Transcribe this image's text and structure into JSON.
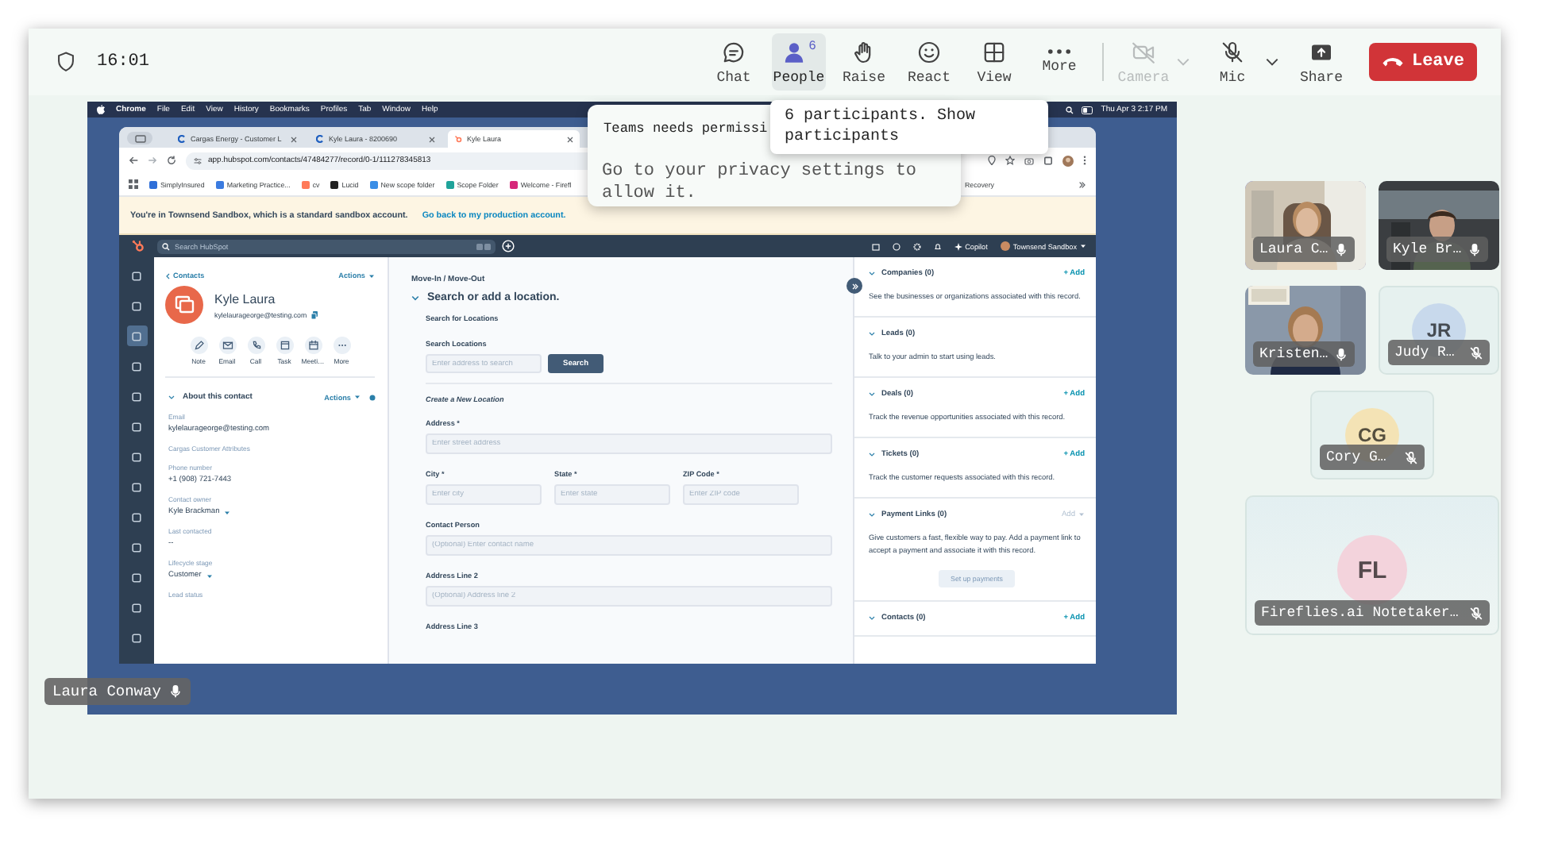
{
  "top_bar": {
    "time": "16:01",
    "buttons": [
      {
        "kind": "chat",
        "label": "Chat",
        "selected": false,
        "disabled": false,
        "dropdown": false
      },
      {
        "kind": "people",
        "label": "People",
        "badge": "6",
        "selected": true,
        "disabled": false,
        "dropdown": false
      },
      {
        "kind": "raise",
        "label": "Raise",
        "selected": false,
        "disabled": false,
        "dropdown": false
      },
      {
        "kind": "react",
        "label": "React",
        "selected": false,
        "disabled": false,
        "dropdown": false
      },
      {
        "kind": "view",
        "label": "View",
        "selected": false,
        "disabled": false,
        "dropdown": false
      },
      {
        "kind": "more",
        "label": "More",
        "selected": false,
        "disabled": false,
        "dropdown": false
      },
      {
        "kind": "camera",
        "label": "Camera",
        "selected": false,
        "disabled": true,
        "dropdown": true
      },
      {
        "kind": "mic",
        "label": "Mic",
        "selected": false,
        "disabled": false,
        "dropdown": true
      },
      {
        "kind": "share",
        "label": "Share",
        "selected": false,
        "disabled": false,
        "dropdown": false
      }
    ],
    "leave": "Leave"
  },
  "permission_popup": {
    "title": "Teams needs permissi",
    "message": "Go to your privacy settings to allow it."
  },
  "people_tooltip": "6 participants. Show participants",
  "shared_screen": {
    "menubar": {
      "items": [
        "Chrome",
        "File",
        "Edit",
        "View",
        "History",
        "Bookmarks",
        "Profiles",
        "Tab",
        "Window",
        "Help"
      ],
      "clock": "Thu Apr 3  2:17 PM"
    },
    "browser": {
      "tabs": [
        {
          "title": "Cargas Energy - Customer L",
          "selected": false
        },
        {
          "title": "Kyle Laura - 8200690",
          "selected": false
        },
        {
          "title": "Kyle Laura",
          "selected": true
        }
      ],
      "url": "app.hubspot.com/contacts/47484277/record/0-1/111278345813",
      "bookmarks": [
        {
          "label": "SimplyInsured",
          "color": "#2f6fd8"
        },
        {
          "label": "Marketing Practice...",
          "color": "#3b7be0"
        },
        {
          "label": "cv",
          "color": "#ff7a59"
        },
        {
          "label": "Lucid",
          "color": "#222222"
        },
        {
          "label": "New scope folder",
          "color": "#3a8ee6"
        },
        {
          "label": "Scope Folder",
          "color": "#1fa39a"
        },
        {
          "label": "Welcome - Firefl",
          "color": "#d6287a"
        }
      ],
      "bookmark_end": "Recovery"
    },
    "banner": {
      "text": "You're in Townsend Sandbox, which is a standard sandbox account.",
      "link": "Go back to my production account."
    },
    "hubspot": {
      "search_placeholder": "Search HubSpot",
      "copilot": "Copilot",
      "account": "Townsend Sandbox",
      "nav_items": [
        {
          "selected": false
        },
        {
          "selected": false
        },
        {
          "selected": true
        },
        {
          "selected": false
        },
        {
          "selected": false
        },
        {
          "selected": false
        },
        {
          "selected": false
        },
        {
          "selected": false
        },
        {
          "selected": false
        },
        {
          "selected": false
        },
        {
          "selected": false
        },
        {
          "selected": false
        },
        {
          "selected": false
        }
      ],
      "contact": {
        "back": "Contacts",
        "actions": "Actions",
        "name": "Kyle Laura",
        "email": "kylelaurageorge@testing.com",
        "quick_actions": [
          {
            "kind": "note",
            "label": "Note"
          },
          {
            "kind": "email",
            "label": "Email"
          },
          {
            "kind": "call",
            "label": "Call"
          },
          {
            "kind": "task",
            "label": "Task"
          },
          {
            "kind": "meeting",
            "label": "Meeti…"
          },
          {
            "kind": "more",
            "label": "More"
          }
        ],
        "about": {
          "title": "About this contact",
          "actions": "Actions",
          "fields": [
            {
              "kind": "field",
              "label": "Email",
              "value": "kylelaurageorge@testing.com"
            },
            {
              "kind": "section",
              "label": "Cargas Customer Attributes"
            },
            {
              "kind": "field",
              "label": "Phone number",
              "value": "+1 (908) 721-7443"
            },
            {
              "kind": "dropdown",
              "label": "Contact owner",
              "value": "Kyle Brackman"
            },
            {
              "kind": "field",
              "label": "Last contacted",
              "value": "--"
            },
            {
              "kind": "dropdown",
              "label": "Lifecycle stage",
              "value": "Customer"
            },
            {
              "kind": "field",
              "label": "Lead status"
            }
          ]
        }
      },
      "form": {
        "breadcrumb": "Move-In / Move-Out",
        "heading": "Search or add a location.",
        "search_title": "Search for Locations",
        "search_label": "Search Locations",
        "search_placeholder": "Enter address to search",
        "search_button": "Search",
        "create_title": "Create a New Location",
        "rows": [
          [
            {
              "label": "Address *",
              "placeholder": "Enter street address"
            }
          ],
          [
            {
              "label": "City *",
              "placeholder": "Enter city"
            },
            {
              "label": "State *",
              "placeholder": "Enter state"
            },
            {
              "label": "ZIP Code *",
              "placeholder": "Enter ZIP code"
            }
          ],
          [
            {
              "label": "Contact Person",
              "placeholder": "(Optional) Enter contact name"
            }
          ],
          [
            {
              "label": "Address Line 2",
              "placeholder": "(Optional) Address line 2"
            }
          ],
          [
            {
              "label": "Address Line 3"
            }
          ]
        ]
      },
      "associations": [
        {
          "title": "Companies (0)",
          "action": "+ Add",
          "action_disabled": false,
          "dropdown": false,
          "description": "See the businesses or organizations associated with this record."
        },
        {
          "title": "Leads (0)",
          "description": "Talk to your admin to start using leads."
        },
        {
          "title": "Deals (0)",
          "action": "+ Add",
          "action_disabled": false,
          "dropdown": false,
          "description": "Track the revenue opportunities associated with this record."
        },
        {
          "title": "Tickets (0)",
          "action": "+ Add",
          "action_disabled": false,
          "dropdown": false,
          "description": "Track the customer requests associated with this record."
        },
        {
          "title": "Payment Links (0)",
          "action": "Add",
          "action_disabled": true,
          "dropdown": true,
          "description": "Give customers a fast, flexible way to pay. Add a payment link to accept a payment and associate it with this record.",
          "button": "Set up payments"
        },
        {
          "title": "Contacts (0)",
          "action": "+ Add",
          "action_disabled": false,
          "dropdown": false
        }
      ]
    }
  },
  "presenter": {
    "name": "Laura Conway"
  },
  "participants": [
    {
      "kind": "video",
      "name": "Laura C…",
      "speaking": true,
      "muted": false
    },
    {
      "kind": "video",
      "name": "Kyle Br…",
      "speaking": false,
      "muted": false
    },
    {
      "kind": "video",
      "name": "Kristen…",
      "speaking": false,
      "muted": false
    },
    {
      "kind": "avatar",
      "name": "Judy R…",
      "initials": "JR",
      "color": "#c8d9ec",
      "speaking": false,
      "muted": true
    },
    {
      "kind": "avatar",
      "name": "Cory G…",
      "initials": "CG",
      "color": "#f4e3b5",
      "speaking": false,
      "muted": true
    },
    {
      "kind": "avatar",
      "name": "Fireflies.ai Notetaker…",
      "initials": "FL",
      "color": "#f3d3dc",
      "speaking": false,
      "muted": true
    }
  ]
}
